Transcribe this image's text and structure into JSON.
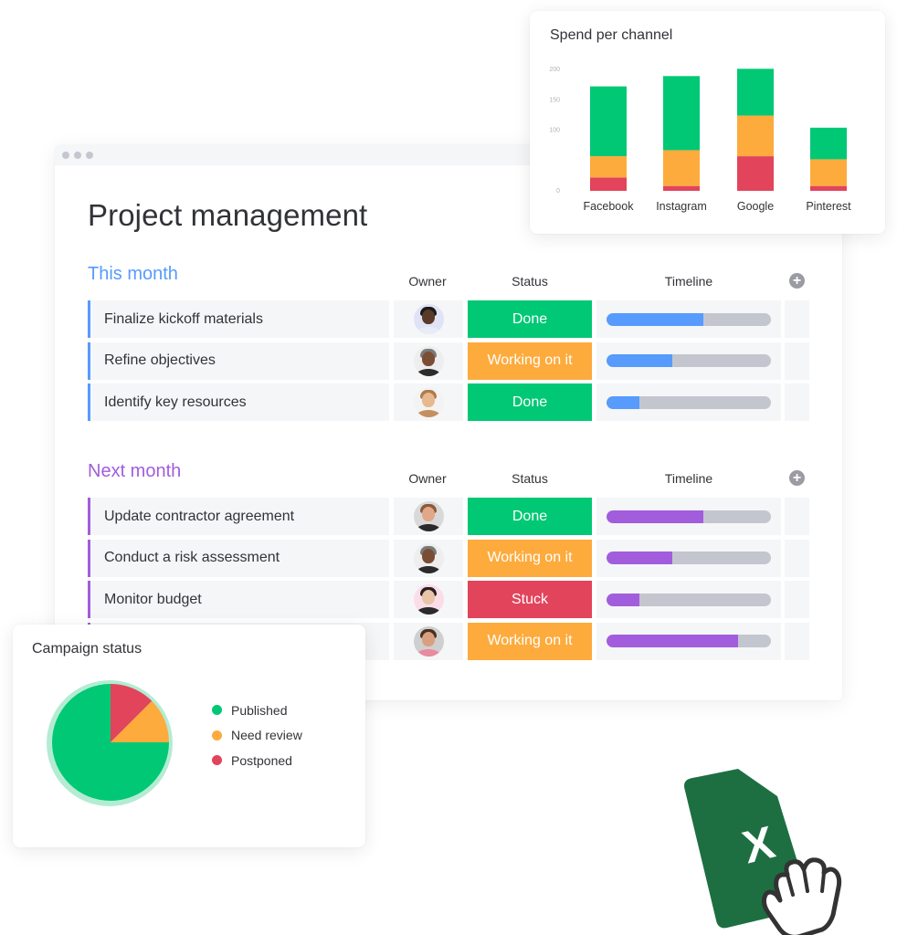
{
  "window": {
    "title": "Project management"
  },
  "colors": {
    "done": "#00c875",
    "working": "#fdab3d",
    "stuck": "#e2445c",
    "this_month_accent": "#579bfc",
    "next_month_accent": "#a25ddc",
    "timeline_track": "#c4c6cf"
  },
  "groups": [
    {
      "title": "This month",
      "color": "#579bfc",
      "columns": {
        "owner": "Owner",
        "status": "Status",
        "timeline": "Timeline"
      },
      "add_column_icon": "plus-circle-icon",
      "rows": [
        {
          "name": "Finalize kickoff materials",
          "owner_avatar": "avatar-1",
          "status": "Done",
          "status_color": "#00c875",
          "timeline_progress": 0.59
        },
        {
          "name": "Refine objectives",
          "owner_avatar": "avatar-2",
          "status": "Working on it",
          "status_color": "#fdab3d",
          "timeline_progress": 0.4
        },
        {
          "name": "Identify key resources",
          "owner_avatar": "avatar-3",
          "status": "Done",
          "status_color": "#00c875",
          "timeline_progress": 0.2
        }
      ]
    },
    {
      "title": "Next month",
      "color": "#a25ddc",
      "columns": {
        "owner": "Owner",
        "status": "Status",
        "timeline": "Timeline"
      },
      "add_column_icon": "plus-circle-icon",
      "rows": [
        {
          "name": "Update contractor agreement",
          "owner_avatar": "avatar-4",
          "status": "Done",
          "status_color": "#00c875",
          "timeline_progress": 0.59
        },
        {
          "name": "Conduct a risk assessment",
          "owner_avatar": "avatar-2",
          "status": "Working on it",
          "status_color": "#fdab3d",
          "timeline_progress": 0.4
        },
        {
          "name": "Monitor budget",
          "owner_avatar": "avatar-5",
          "status": "Stuck",
          "status_color": "#e2445c",
          "timeline_progress": 0.2
        },
        {
          "name": "",
          "owner_avatar": "avatar-6",
          "status": "Working on it",
          "status_color": "#fdab3d",
          "timeline_progress": 0.8
        }
      ]
    }
  ],
  "chart_data": [
    {
      "type": "bar",
      "stacked": true,
      "title": "Spend per channel",
      "categories": [
        "Facebook",
        "Instagram",
        "Google",
        "Pinterest"
      ],
      "series": [
        {
          "name": "Postponed",
          "color": "#e2445c",
          "values": [
            22,
            8,
            57,
            8
          ]
        },
        {
          "name": "Need review",
          "color": "#fdab3d",
          "values": [
            35,
            59,
            67,
            44
          ]
        },
        {
          "name": "Published",
          "color": "#00c875",
          "values": [
            115,
            122,
            77,
            52
          ]
        }
      ],
      "yticks": [
        0,
        100,
        150,
        200
      ],
      "ylim": [
        0,
        200
      ],
      "xlabel": "",
      "ylabel": "",
      "grid": false
    },
    {
      "type": "pie",
      "title": "Campaign status",
      "legend_position": "right",
      "slices": [
        {
          "label": "Published",
          "value": 75,
          "color": "#00c875"
        },
        {
          "label": "Need review",
          "value": 12.5,
          "color": "#fdab3d"
        },
        {
          "label": "Postponed",
          "value": 12.5,
          "color": "#e2445c"
        }
      ]
    }
  ],
  "legend": [
    {
      "label": "Published",
      "color": "#00c875"
    },
    {
      "label": "Need review",
      "color": "#fdab3d"
    },
    {
      "label": "Postponed",
      "color": "#e2445c"
    }
  ],
  "excel_icon": {
    "label": "X",
    "color": "#1d6f42",
    "icon": "excel-file-icon"
  },
  "cursor": {
    "icon": "grab-hand-cursor-icon"
  }
}
